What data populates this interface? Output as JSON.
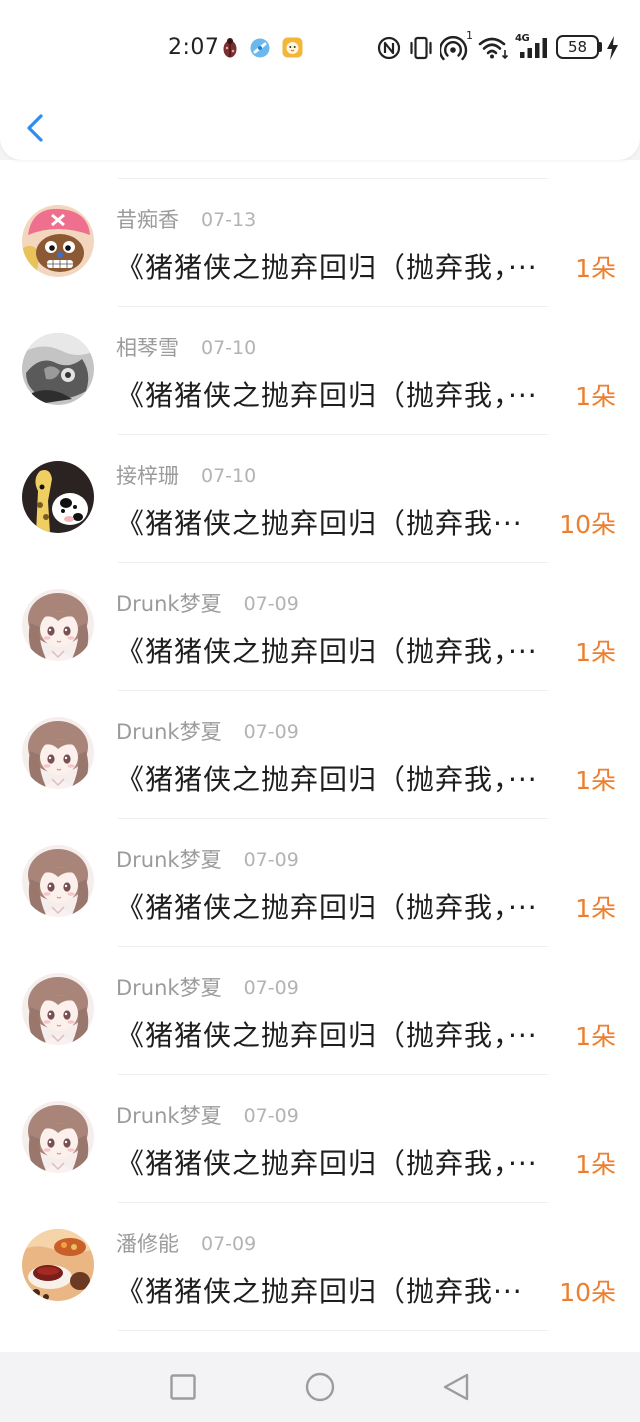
{
  "status_bar": {
    "time": "2:07",
    "notification_icons": [
      "ladybug-app-icon",
      "blue-app-icon",
      "yellow-app-icon"
    ],
    "system_icons": [
      "nfc-icon",
      "vibrate-icon",
      "hotspot-icon",
      "wifi-icon",
      "cellular-signal-icon",
      "battery-icon",
      "charging-icon"
    ],
    "hotspot_badge": "1",
    "network_type": "4G",
    "battery_level": "58"
  },
  "header": {
    "back_icon": "chevron-left-icon"
  },
  "colors": {
    "accent": "#2c8cf0",
    "gift_count": "#ef7d2e",
    "name_text": "#9b9b9b",
    "date_text": "#b3b3b3",
    "message_text": "#1e1e1e",
    "nav_bar_bg": "#f3f3f5"
  },
  "gift_list": [
    {
      "name": "昔痴香",
      "date": "07-13",
      "message": "《猪猪侠之抛弃回归（抛弃我，···",
      "gift": "1朵"
    },
    {
      "name": "相琴雪",
      "date": "07-10",
      "message": "《猪猪侠之抛弃回归（抛弃我，···",
      "gift": "1朵"
    },
    {
      "name": "接梓珊",
      "date": "07-10",
      "message": "《猪猪侠之抛弃回归（抛弃我···",
      "gift": "10朵"
    },
    {
      "name": "Drunk梦夏",
      "date": "07-09",
      "message": "《猪猪侠之抛弃回归（抛弃我，···",
      "gift": "1朵"
    },
    {
      "name": "Drunk梦夏",
      "date": "07-09",
      "message": "《猪猪侠之抛弃回归（抛弃我，···",
      "gift": "1朵"
    },
    {
      "name": "Drunk梦夏",
      "date": "07-09",
      "message": "《猪猪侠之抛弃回归（抛弃我，···",
      "gift": "1朵"
    },
    {
      "name": "Drunk梦夏",
      "date": "07-09",
      "message": "《猪猪侠之抛弃回归（抛弃我，···",
      "gift": "1朵"
    },
    {
      "name": "Drunk梦夏",
      "date": "07-09",
      "message": "《猪猪侠之抛弃回归（抛弃我，···",
      "gift": "1朵"
    },
    {
      "name": "潘修能",
      "date": "07-09",
      "message": "《猪猪侠之抛弃回归（抛弃我···",
      "gift": "10朵"
    }
  ],
  "nav_bar": {
    "icons": [
      "recent-apps-icon",
      "home-icon",
      "back-icon"
    ]
  }
}
